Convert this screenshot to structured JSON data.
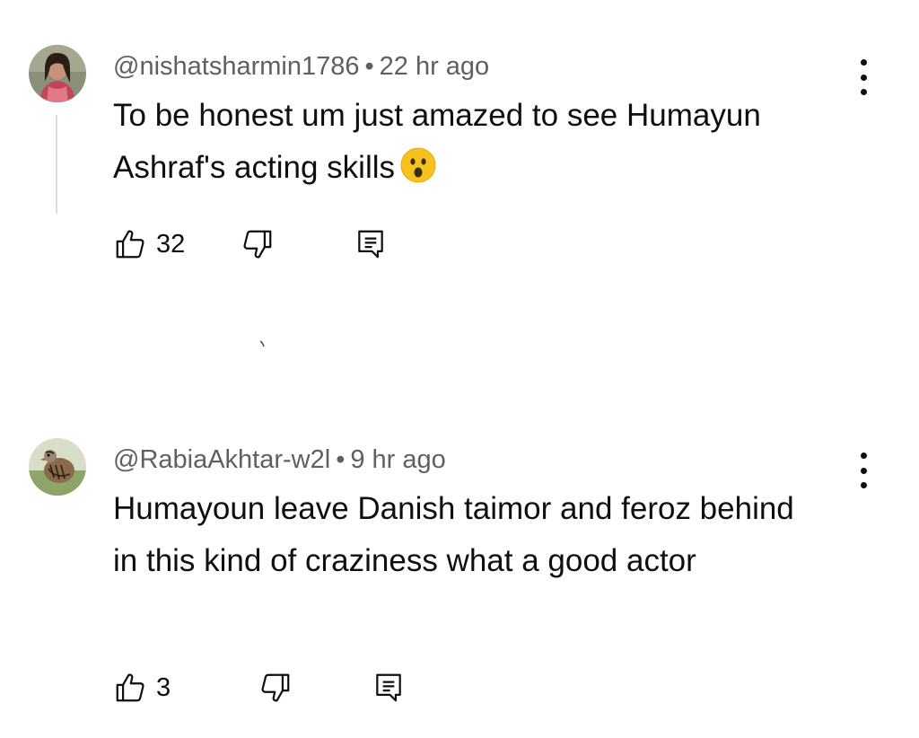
{
  "comments": [
    {
      "author": "@nishatsharmin1786",
      "separator": "•",
      "time": "22 hr ago",
      "text": "To be honest um just amazed to see Humayun Ashraf's acting skills",
      "emoji": "face-with-open-mouth",
      "likes": "32"
    },
    {
      "author": "@RabiaAkhtar-w2l",
      "separator": "•",
      "time": "9 hr ago",
      "text": "Humayoun leave Danish taimor and feroz behind in this kind of craziness what a good actor",
      "likes": "3"
    }
  ],
  "icons": {
    "like": "thumbs-up-icon",
    "dislike": "thumbs-down-icon",
    "reply": "reply-comment-icon",
    "menu": "more-vertical-icon"
  },
  "colors": {
    "text": "#0f0f0f",
    "meta": "#606060",
    "thread_line": "#dcdcdc",
    "emoji": "#f7c21e"
  }
}
